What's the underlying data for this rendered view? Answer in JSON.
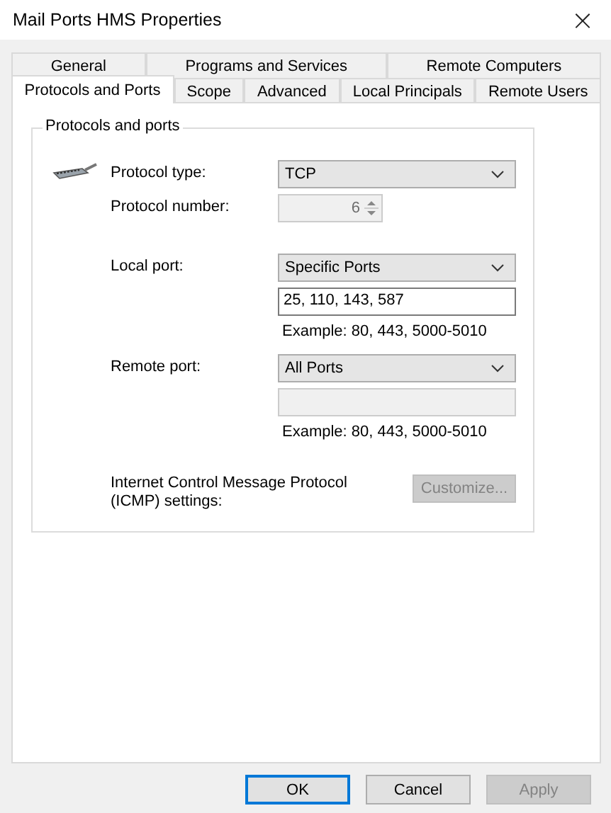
{
  "window": {
    "title": "Mail Ports HMS Properties",
    "close": "×"
  },
  "tab_rows": [
    [
      {
        "label": "General",
        "selected": false
      },
      {
        "label": "Programs and Services",
        "selected": false
      },
      {
        "label": "Remote Computers",
        "selected": false
      }
    ],
    [
      {
        "label": "Protocols and Ports",
        "selected": true
      },
      {
        "label": "Scope",
        "selected": false
      },
      {
        "label": "Advanced",
        "selected": false
      },
      {
        "label": "Local Principals",
        "selected": false
      },
      {
        "label": "Remote Users",
        "selected": false
      }
    ]
  ],
  "group": {
    "title": "Protocols and ports",
    "rows": [
      {
        "kind": "dropdown",
        "label": "Protocol type:",
        "value": "TCP",
        "disabled": false,
        "icon": true
      },
      {
        "kind": "spinner",
        "label": "Protocol number:",
        "value": "6",
        "disabled": true
      },
      {
        "kind": "dropdown",
        "label": "Local port:",
        "value": "Specific Ports",
        "disabled": false,
        "gap": true
      },
      {
        "kind": "text",
        "value": "25, 110, 143, 587",
        "disabled": false
      },
      {
        "kind": "hint",
        "value": "Example: 80, 443, 5000-5010"
      },
      {
        "kind": "dropdown",
        "label": "Remote port:",
        "value": "All Ports",
        "disabled": false
      },
      {
        "kind": "text",
        "value": "",
        "disabled": true
      },
      {
        "kind": "hint",
        "value": "Example: 80, 443, 5000-5010"
      },
      {
        "kind": "button",
        "label": "Internet Control Message Protocol (ICMP) settings:",
        "value": "Customize...",
        "disabled": true
      }
    ]
  },
  "buttons": [
    {
      "label": "OK",
      "default": true,
      "disabled": false
    },
    {
      "label": "Cancel",
      "default": false,
      "disabled": false
    },
    {
      "label": "Apply",
      "default": false,
      "disabled": true
    }
  ]
}
